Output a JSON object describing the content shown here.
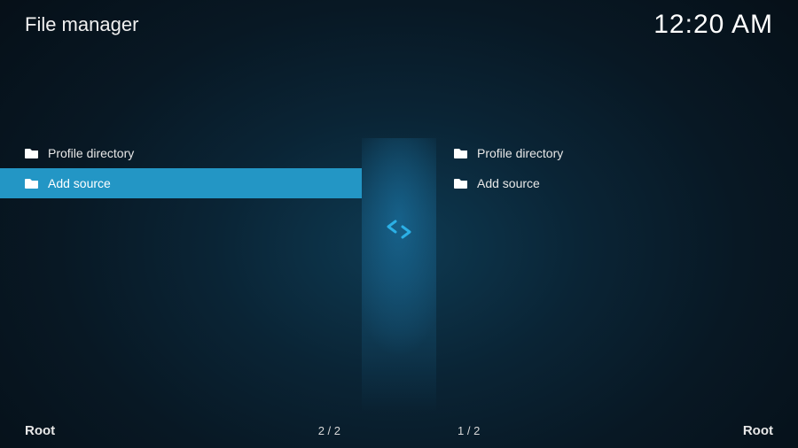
{
  "header": {
    "title": "File manager",
    "clock": "12:20 AM"
  },
  "leftPane": {
    "items": [
      {
        "label": "Profile directory",
        "selected": false
      },
      {
        "label": "Add source",
        "selected": true
      }
    ],
    "footer": {
      "location": "Root",
      "count": "2 / 2"
    }
  },
  "rightPane": {
    "items": [
      {
        "label": "Profile directory",
        "selected": false
      },
      {
        "label": "Add source",
        "selected": false
      }
    ],
    "footer": {
      "location": "Root",
      "count": "1 / 2"
    }
  }
}
